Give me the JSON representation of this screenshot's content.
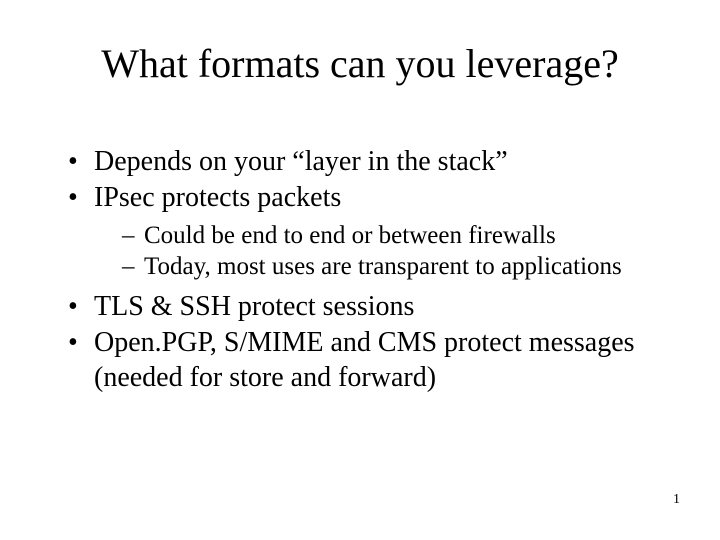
{
  "title": "What formats can you leverage?",
  "bullets": {
    "b0": "Depends on your “layer in the stack”",
    "b1": "IPsec protects packets",
    "b1s0": "Could be end to end or between firewalls",
    "b1s1": "Today, most uses are transparent to applications",
    "b2": "TLS & SSH protect sessions",
    "b3": "Open.PGP, S/MIME and CMS protect messages (needed for store and forward)"
  },
  "pageNumber": "1"
}
